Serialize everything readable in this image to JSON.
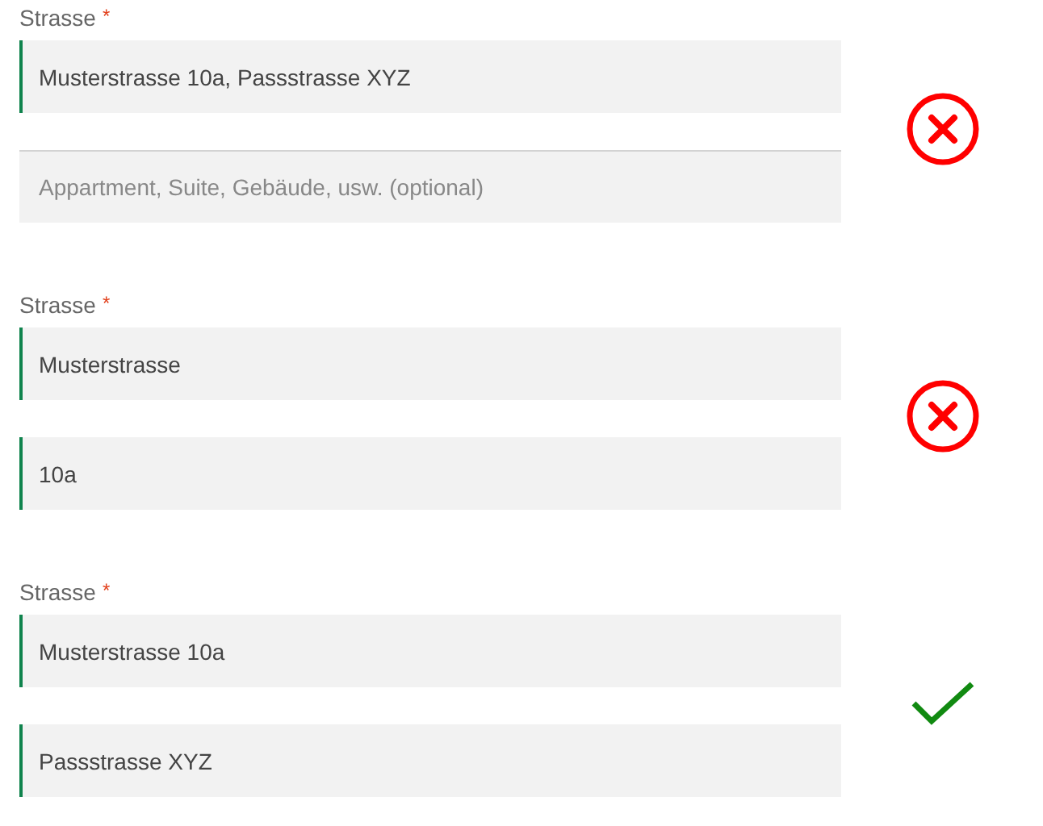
{
  "groups": [
    {
      "label": "Strasse",
      "required_mark": "*",
      "valid": false,
      "fields": [
        {
          "value": "Musterstrasse 10a, Passstrasse XYZ",
          "validated": true
        },
        {
          "placeholder": "Appartment, Suite, Gebäude, usw. (optional)",
          "validated": false
        }
      ]
    },
    {
      "label": "Strasse",
      "required_mark": "*",
      "valid": false,
      "fields": [
        {
          "value": "Musterstrasse",
          "validated": true
        },
        {
          "value": "10a",
          "validated": true
        }
      ]
    },
    {
      "label": "Strasse",
      "required_mark": "*",
      "valid": true,
      "fields": [
        {
          "value": "Musterstrasse 10a",
          "validated": true
        },
        {
          "value": "Passstrasse XYZ",
          "validated": true
        }
      ]
    }
  ]
}
